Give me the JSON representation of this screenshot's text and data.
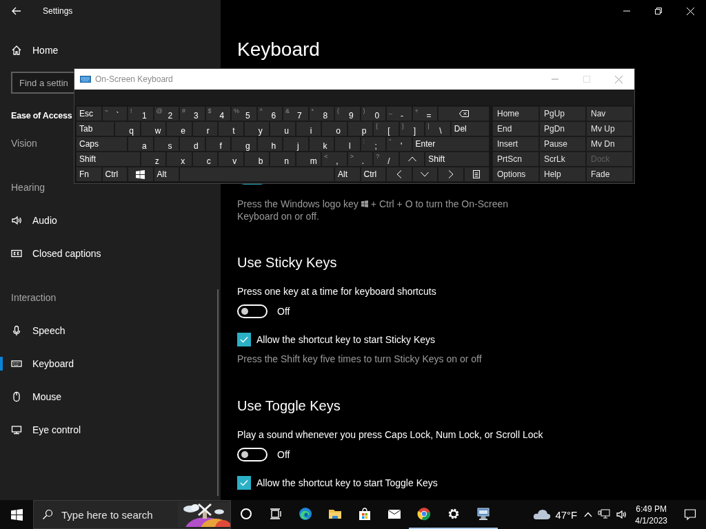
{
  "window": {
    "title": "Settings"
  },
  "sidebar": {
    "home": "Home",
    "search": {
      "placeholder": "Find a settin"
    },
    "section": "Ease of Access",
    "items": [
      {
        "kind": "header",
        "label": "Vision"
      },
      {
        "kind": "header",
        "label": "Hearing"
      },
      {
        "kind": "audio",
        "label": "Audio",
        "selected": false
      },
      {
        "kind": "captions",
        "label": "Closed captions",
        "selected": false
      },
      {
        "kind": "header",
        "label": "Interaction"
      },
      {
        "kind": "speech",
        "label": "Speech",
        "selected": false
      },
      {
        "kind": "keyboard",
        "label": "Keyboard",
        "selected": true
      },
      {
        "kind": "mouse",
        "label": "Mouse",
        "selected": false
      },
      {
        "kind": "eye",
        "label": "Eye control",
        "selected": false
      }
    ]
  },
  "content": {
    "title": "Keyboard",
    "osk_toggle": {
      "on": true
    },
    "osk_hint_before": "Press the Windows logo key",
    "osk_hint_after": "+ Ctrl + O to turn the On-Screen",
    "osk_hint_end": "Keyboard on or off.",
    "sections": [
      {
        "heading": "Use Sticky Keys",
        "label": "Press one key at a time for keyboard shortcuts",
        "toggle": {
          "on": false,
          "state_text": "Off"
        },
        "checkbox": {
          "checked": true,
          "label": "Allow the shortcut key to start Sticky Keys"
        },
        "hint": "Press the Shift key five times to turn Sticky Keys on or off"
      },
      {
        "heading": "Use Toggle Keys",
        "label": "Play a sound whenever you press Caps Lock, Num Lock, or Scroll Lock",
        "toggle": {
          "on": false,
          "state_text": "Off"
        },
        "checkbox": {
          "checked": true,
          "label": "Allow the shortcut key to start Toggle Keys"
        }
      }
    ]
  },
  "osk": {
    "title": "On-Screen Keyboard",
    "main_rows": [
      [
        {
          "kind": "text",
          "label": "Esc"
        },
        {
          "kind": "char",
          "shift": "~",
          "label": "`"
        },
        {
          "kind": "char",
          "shift": "!",
          "label": "1"
        },
        {
          "kind": "char",
          "shift": "@",
          "label": "2"
        },
        {
          "kind": "char",
          "shift": "#",
          "label": "3"
        },
        {
          "kind": "char",
          "shift": "$",
          "label": "4"
        },
        {
          "kind": "char",
          "shift": "%",
          "label": "5"
        },
        {
          "kind": "char",
          "shift": "^",
          "label": "6"
        },
        {
          "kind": "char",
          "shift": "&",
          "label": "7"
        },
        {
          "kind": "char",
          "shift": "*",
          "label": "8"
        },
        {
          "kind": "char",
          "shift": "(",
          "label": "9"
        },
        {
          "kind": "char",
          "shift": ")",
          "label": "0"
        },
        {
          "kind": "char",
          "shift": "_",
          "label": "-"
        },
        {
          "kind": "char",
          "shift": "+",
          "label": "="
        },
        {
          "kind": "backspace"
        }
      ],
      [
        {
          "kind": "text",
          "label": "Tab"
        },
        {
          "kind": "char",
          "label": "q"
        },
        {
          "kind": "char",
          "label": "w"
        },
        {
          "kind": "char",
          "label": "e"
        },
        {
          "kind": "char",
          "label": "r"
        },
        {
          "kind": "char",
          "label": "t"
        },
        {
          "kind": "char",
          "label": "y"
        },
        {
          "kind": "char",
          "label": "u"
        },
        {
          "kind": "char",
          "label": "i"
        },
        {
          "kind": "char",
          "label": "o"
        },
        {
          "kind": "char",
          "label": "p"
        },
        {
          "kind": "char",
          "shift": "{",
          "label": "["
        },
        {
          "kind": "char",
          "shift": "}",
          "label": "]"
        },
        {
          "kind": "char",
          "shift": "|",
          "label": "\\"
        },
        {
          "kind": "text",
          "label": "Del"
        }
      ],
      [
        {
          "kind": "text",
          "label": "Caps"
        },
        {
          "kind": "char",
          "label": "a"
        },
        {
          "kind": "char",
          "label": "s"
        },
        {
          "kind": "char",
          "label": "d"
        },
        {
          "kind": "char",
          "label": "f"
        },
        {
          "kind": "char",
          "label": "g"
        },
        {
          "kind": "char",
          "label": "h"
        },
        {
          "kind": "char",
          "label": "j"
        },
        {
          "kind": "char",
          "label": "k"
        },
        {
          "kind": "char",
          "label": "l"
        },
        {
          "kind": "char",
          "shift": ":",
          "label": ";"
        },
        {
          "kind": "char",
          "shift": "\"",
          "label": "'"
        },
        {
          "kind": "text",
          "label": "Enter"
        }
      ],
      [
        {
          "kind": "text",
          "label": "Shift"
        },
        {
          "kind": "char",
          "label": "z"
        },
        {
          "kind": "char",
          "label": "x"
        },
        {
          "kind": "char",
          "label": "c"
        },
        {
          "kind": "char",
          "label": "v"
        },
        {
          "kind": "char",
          "label": "b"
        },
        {
          "kind": "char",
          "label": "n"
        },
        {
          "kind": "char",
          "label": "m"
        },
        {
          "kind": "char",
          "shift": "<",
          "label": ","
        },
        {
          "kind": "char",
          "shift": ">",
          "label": "."
        },
        {
          "kind": "char",
          "shift": "?",
          "label": "/"
        },
        {
          "kind": "up"
        },
        {
          "kind": "text",
          "label": "Shift"
        }
      ],
      [
        {
          "kind": "text",
          "label": "Fn"
        },
        {
          "kind": "text",
          "label": "Ctrl"
        },
        {
          "kind": "windows"
        },
        {
          "kind": "text",
          "label": "Alt"
        },
        {
          "kind": "space"
        },
        {
          "kind": "text",
          "label": "Alt"
        },
        {
          "kind": "text",
          "label": "Ctrl"
        },
        {
          "kind": "left"
        },
        {
          "kind": "down"
        },
        {
          "kind": "right"
        },
        {
          "kind": "menu"
        }
      ]
    ],
    "side_keys": [
      {
        "label": "Home",
        "disabled": false
      },
      {
        "label": "PgUp",
        "disabled": false
      },
      {
        "label": "Nav",
        "disabled": false
      },
      {
        "label": "End",
        "disabled": false
      },
      {
        "label": "PgDn",
        "disabled": false
      },
      {
        "label": "Mv Up",
        "disabled": false
      },
      {
        "label": "Insert",
        "disabled": false
      },
      {
        "label": "Pause",
        "disabled": false
      },
      {
        "label": "Mv Dn",
        "disabled": false
      },
      {
        "label": "PrtScn",
        "disabled": false
      },
      {
        "label": "ScrLk",
        "disabled": false
      },
      {
        "label": "Dock",
        "disabled": true
      },
      {
        "label": "Options",
        "disabled": false
      },
      {
        "label": "Help",
        "disabled": false
      },
      {
        "label": "Fade",
        "disabled": false
      }
    ]
  },
  "taskbar": {
    "search": {
      "placeholder": "Type here to search"
    },
    "apps": [
      {
        "kind": "cortana",
        "running": false
      },
      {
        "kind": "taskview",
        "running": false
      },
      {
        "kind": "edge",
        "running": false
      },
      {
        "kind": "folder",
        "running": false
      },
      {
        "kind": "store",
        "running": false
      },
      {
        "kind": "mail",
        "running": false
      },
      {
        "kind": "chrome",
        "running": true
      },
      {
        "kind": "gear",
        "running": true
      },
      {
        "kind": "osk",
        "running": true
      }
    ],
    "temperature": "47°F",
    "time": "6:49 PM",
    "date": "4/1/2023"
  }
}
